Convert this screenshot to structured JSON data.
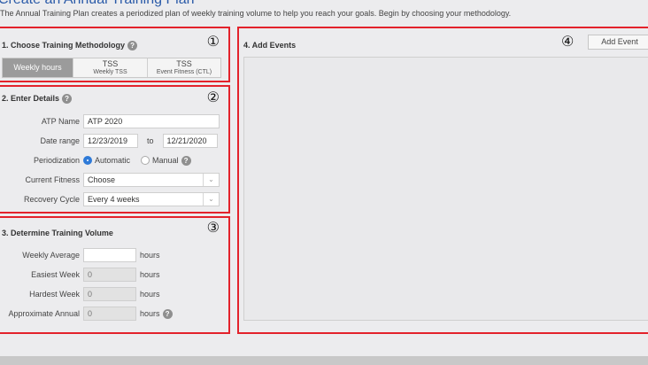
{
  "header": {
    "title": "Create an Annual Training Plan",
    "intro": "The Annual Training Plan creates a periodized plan of weekly training volume to help you reach your goals. Begin by choosing your methodology."
  },
  "methodology": {
    "title": "1. Choose Training Methodology",
    "badge": "①",
    "options": [
      {
        "label": "Weekly hours",
        "sub": ""
      },
      {
        "label": "TSS",
        "sub": "Weekly TSS"
      },
      {
        "label": "TSS",
        "sub": "Event Fitness (CTL)"
      }
    ],
    "selected": "Weekly hours"
  },
  "details": {
    "title": "2. Enter Details",
    "badge": "②",
    "atp_name_label": "ATP Name",
    "atp_name_value": "ATP 2020",
    "date_range_label": "Date range",
    "date_start": "12/23/2019",
    "date_to": "to",
    "date_end": "12/21/2020",
    "periodization_label": "Periodization",
    "periodization_automatic": "Automatic",
    "periodization_manual": "Manual",
    "periodization_selected": "Automatic",
    "current_fitness_label": "Current Fitness",
    "current_fitness_value": "Choose",
    "recovery_cycle_label": "Recovery Cycle",
    "recovery_cycle_value": "Every 4 weeks"
  },
  "volume": {
    "title": "3. Determine Training Volume",
    "badge": "③",
    "weekly_average_label": "Weekly Average",
    "weekly_average_value": "",
    "easiest_week_label": "Easiest Week",
    "easiest_week_value": "0",
    "hardest_week_label": "Hardest Week",
    "hardest_week_value": "0",
    "approx_annual_label": "Approximate Annual",
    "approx_annual_value": "0",
    "unit": "hours"
  },
  "events": {
    "title": "4. Add Events",
    "badge": "④",
    "add_event_label": "Add Event"
  },
  "colors": {
    "highlight_border": "#e3222b",
    "title_blue": "#2a5aa8",
    "radio_on": "#2f7ad8"
  }
}
